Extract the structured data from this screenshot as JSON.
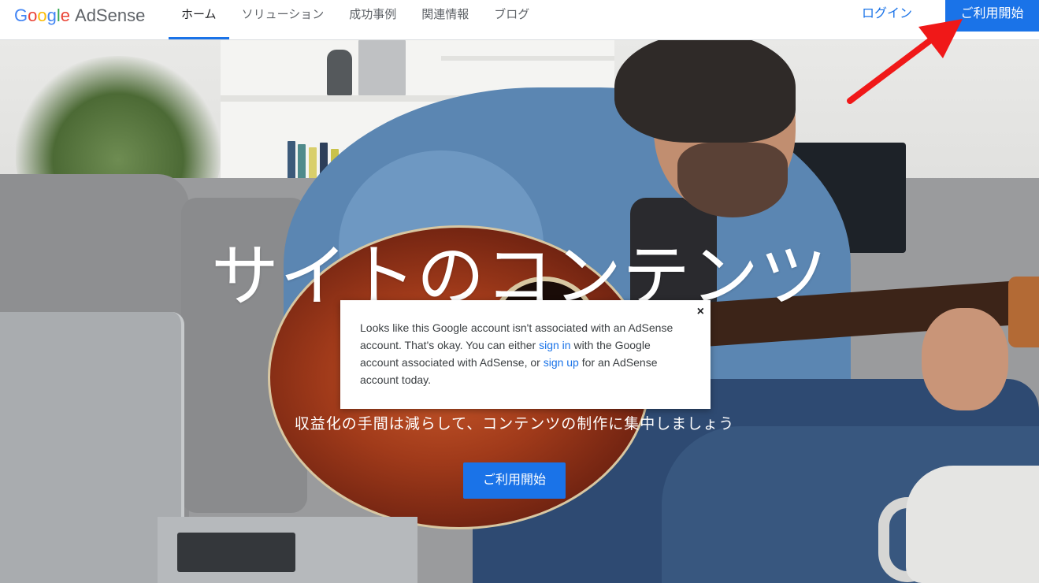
{
  "header": {
    "logo_google": [
      "G",
      "o",
      "o",
      "g",
      "l",
      "e"
    ],
    "logo_product": "AdSense",
    "nav": [
      {
        "label": "ホーム",
        "active": true
      },
      {
        "label": "ソリューション",
        "active": false
      },
      {
        "label": "成功事例",
        "active": false
      },
      {
        "label": "関連情報",
        "active": false
      },
      {
        "label": "ブログ",
        "active": false
      }
    ],
    "login_label": "ログイン",
    "start_label": "ご利用開始"
  },
  "hero": {
    "title": "サイトのコンテンツ",
    "subtitle": "収益化の手間は減らして、コンテンツの制作に集中しましょう",
    "button_label": "ご利用開始"
  },
  "dialog": {
    "text_1": "Looks like this Google account isn't associated with an AdSense account. That's okay. You can either ",
    "link_sign_in": "sign in",
    "text_2": " with the Google account associated with AdSense, or ",
    "link_sign_up": "sign up",
    "text_3": " for an AdSense account today.",
    "close_glyph": "×"
  },
  "colors": {
    "accent": "#1a73e8",
    "annotation_arrow": "#f01818"
  },
  "icons": {
    "close": "close-icon",
    "annotation": "arrow-annotation-icon"
  }
}
